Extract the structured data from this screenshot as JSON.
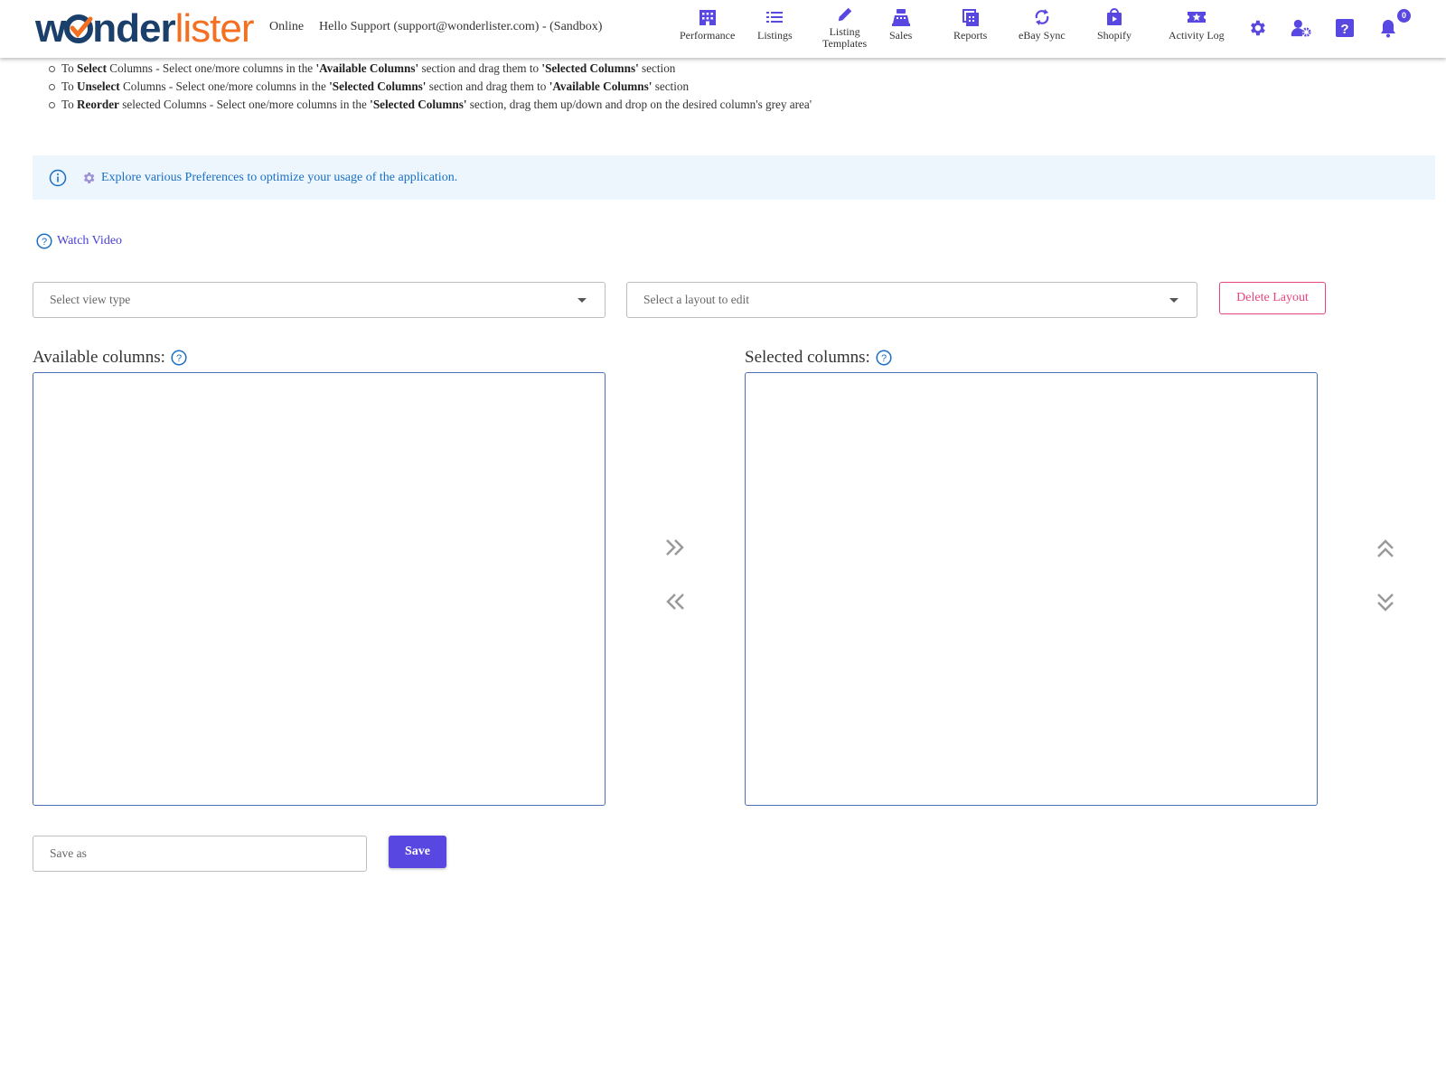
{
  "header": {
    "logo_part1": "w",
    "logo_part2": "nder",
    "logo_part3": "lister",
    "status": "Online",
    "greeting": "Hello Support (support@wonderlister.com) - (Sandbox)",
    "nav": [
      {
        "label": "Performance",
        "icon": "building-icon"
      },
      {
        "label": "Listings",
        "icon": "list-icon"
      },
      {
        "label": "Listing",
        "label2": "Templates",
        "icon": "pencil-icon"
      },
      {
        "label": "Sales",
        "icon": "cash-register-icon"
      },
      {
        "label": "Reports",
        "icon": "reports-icon"
      },
      {
        "label": "eBay Sync",
        "icon": "sync-icon"
      },
      {
        "label": "Shopify",
        "icon": "shopify-bag-icon"
      },
      {
        "label": "Activity Log",
        "icon": "ticket-star-icon"
      }
    ],
    "notifications_count": "0"
  },
  "instructions": [
    {
      "pre": "To ",
      "bold1": "Select",
      "mid": " Columns - Select one/more columns in the ",
      "bold2": "'Available Columns'",
      "mid2": " section and drag them to ",
      "bold3": "'Selected Columns'",
      "post": " section"
    },
    {
      "pre": "To ",
      "bold1": "Unselect",
      "mid": " Columns - Select one/more columns in the ",
      "bold2": "'Selected Columns'",
      "mid2": " section and drag them to ",
      "bold3": "'Available Columns'",
      "post": " section"
    },
    {
      "pre": "To ",
      "bold1": "Reorder",
      "mid": " selected Columns - Select one/more columns in the ",
      "bold2": "'Selected Columns'",
      "mid2": " section, drag them up/down and drop on the desired column's grey area'",
      "bold3": "",
      "post": ""
    }
  ],
  "info_banner": "Explore various Preferences to optimize your usage of the application.",
  "watch_video": "Watch Video",
  "view_type_select": {
    "placeholder": "Select view type"
  },
  "layout_select": {
    "placeholder": "Select a layout to edit"
  },
  "delete_layout": "Delete Layout",
  "available_columns_label": "Available columns:",
  "selected_columns_label": "Selected columns:",
  "save_as": {
    "placeholder": "Save as"
  },
  "save_button": "Save",
  "colors": {
    "accent": "#5847e0",
    "logo_dark": "#1b3f6b",
    "logo_orange": "#f36f21",
    "danger": "#e8457a",
    "info_bg": "#eef6fd"
  }
}
